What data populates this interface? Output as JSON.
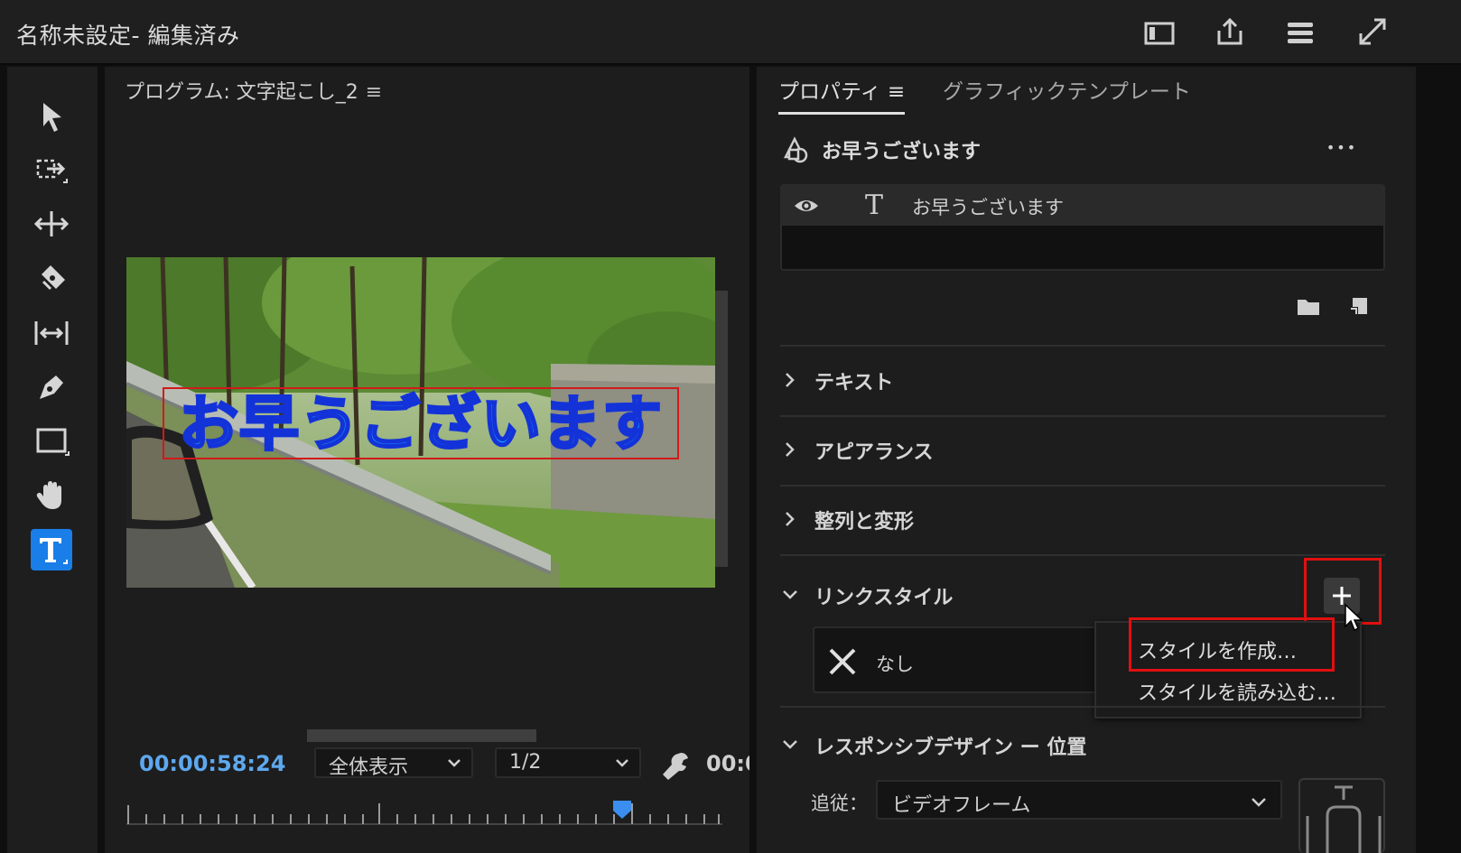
{
  "window": {
    "title": "名称未設定- 編集済み"
  },
  "titlebar_icons": [
    "panel-layout-icon",
    "share-export-icon",
    "progress-list-icon",
    "fullscreen-icon"
  ],
  "tools": [
    "selection-tool-icon",
    "track-select-forward-icon",
    "ripple-edit-icon",
    "razor-icon",
    "slip-icon",
    "pen-icon",
    "rectangle-icon",
    "hand-icon",
    "type-tool-icon"
  ],
  "active_tool": "type-tool-icon",
  "monitor": {
    "title": "プログラム: 文字起こし_2",
    "menu_glyph": "≡",
    "overlay_text": "お早うございます",
    "timecode": "00:00:58:24",
    "zoom_label": "全体表示",
    "resolution_label": "1/2",
    "timecode_right": "00:0"
  },
  "properties": {
    "tabs": [
      {
        "label": "プロパティ ≡",
        "active": true
      },
      {
        "label": "グラフィックテンプレート",
        "active": false
      }
    ],
    "graphic_name": "お早うございます",
    "more_glyph": "•••",
    "layer": {
      "type_glyph": "T",
      "name": "お早うございます"
    },
    "sections": [
      {
        "label": "テキスト",
        "expanded": false
      },
      {
        "label": "アピアランス",
        "expanded": false
      },
      {
        "label": "整列と変形",
        "expanded": false
      },
      {
        "label": "リンクスタイル",
        "expanded": true
      },
      {
        "label": "レスポンシブデザイン ー 位置",
        "expanded": true
      }
    ],
    "style_none_label": "なし",
    "style_menu": [
      "スタイルを作成…",
      "スタイルを読み込む…"
    ],
    "follow_label": "追従：",
    "follow_value": "ビデオフレーム"
  },
  "colors": {
    "accent": "#1a7ee8",
    "timecode": "#5ea8ee",
    "highlight": "#e01010",
    "title_fill": "#18a0ff",
    "title_stroke": "#1333d8"
  }
}
